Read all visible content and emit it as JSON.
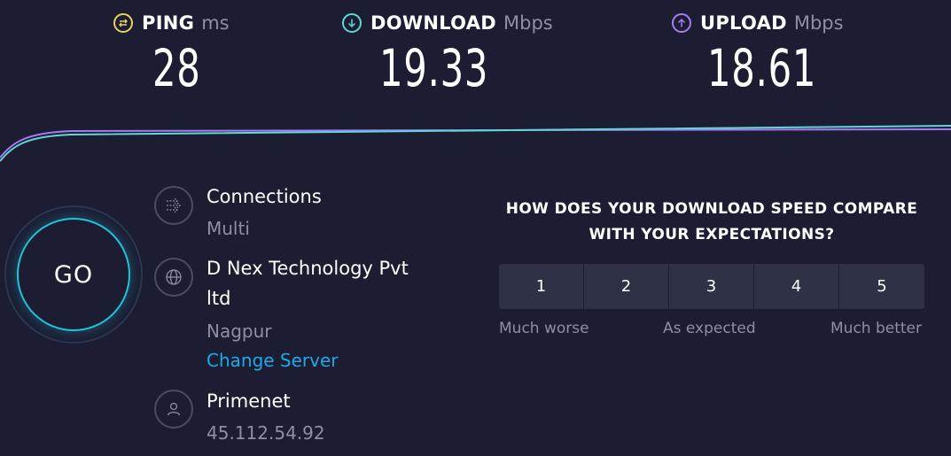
{
  "metrics": {
    "ping": {
      "name": "PING",
      "unit": "ms",
      "value": "28",
      "color": "#e6d35b",
      "icon": "ping-icon"
    },
    "download": {
      "name": "DOWNLOAD",
      "unit": "Mbps",
      "value": "19.33",
      "color": "#5fd7d6",
      "icon": "download-arrow-icon"
    },
    "upload": {
      "name": "UPLOAD",
      "unit": "Mbps",
      "value": "18.61",
      "color": "#a77bf3",
      "icon": "upload-arrow-icon"
    }
  },
  "go_label": "GO",
  "connections": {
    "title": "Connections",
    "value": "Multi",
    "icon": "connections-icon"
  },
  "server": {
    "title_line1": "D Nex Technology Pvt",
    "title_line2": "ltd",
    "location": "Nagpur",
    "change_label": "Change Server",
    "icon": "globe-icon"
  },
  "provider": {
    "name": "Primenet",
    "ip": "45.112.54.92",
    "icon": "user-icon"
  },
  "survey": {
    "question_line1": "HOW DOES YOUR DOWNLOAD SPEED COMPARE",
    "question_line2": "WITH YOUR EXPECTATIONS?",
    "options": [
      "1",
      "2",
      "3",
      "4",
      "5"
    ],
    "label_low": "Much worse",
    "label_mid": "As expected",
    "label_high": "Much better"
  },
  "colors": {
    "background": "#1c1d33",
    "accent_cyan": "#23c2d6",
    "link": "#1fa9e6"
  }
}
